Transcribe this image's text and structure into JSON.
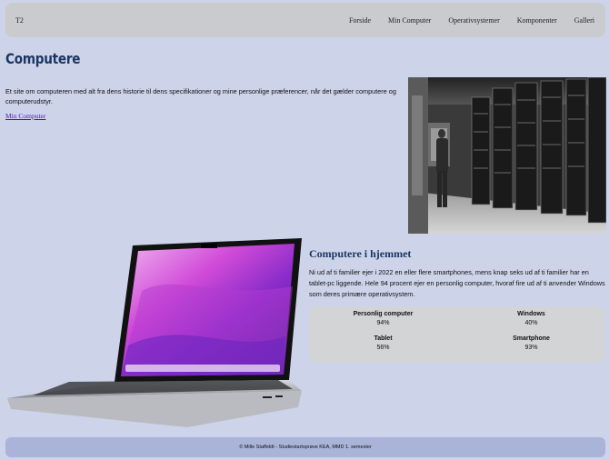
{
  "nav": {
    "brand": "T2",
    "links": [
      "Forside",
      "Min Computer",
      "Operativsystemer",
      "Komponenter",
      "Galleri"
    ]
  },
  "page": {
    "title": "Computere",
    "intro": "Et site om computeren med alt fra dens historie til dens specifikationer og mine personlige præferencer, når det gælder computere og computerudstyr.",
    "link": "Min Computer"
  },
  "section": {
    "title": "Computere i hjemmet",
    "text": "Ni ud af ti familier ejer i 2022 en eller flere smartphones, mens knap seks ud af ti familier har en tablet-pc liggende. Hele 94 procent ejer en personlig computer, hvoraf fire ud af ti anvender Windows som deres primære operativsystem."
  },
  "stats": [
    {
      "label": "Personlig computer",
      "value": "94%"
    },
    {
      "label": "Windows",
      "value": "40%"
    },
    {
      "label": "Tablet",
      "value": "56%"
    },
    {
      "label": "Smartphone",
      "value": "93%"
    }
  ],
  "footer": {
    "text": "© Mille Staffeldt - Studiestartsprøve KEA, MMD 1. semester"
  }
}
